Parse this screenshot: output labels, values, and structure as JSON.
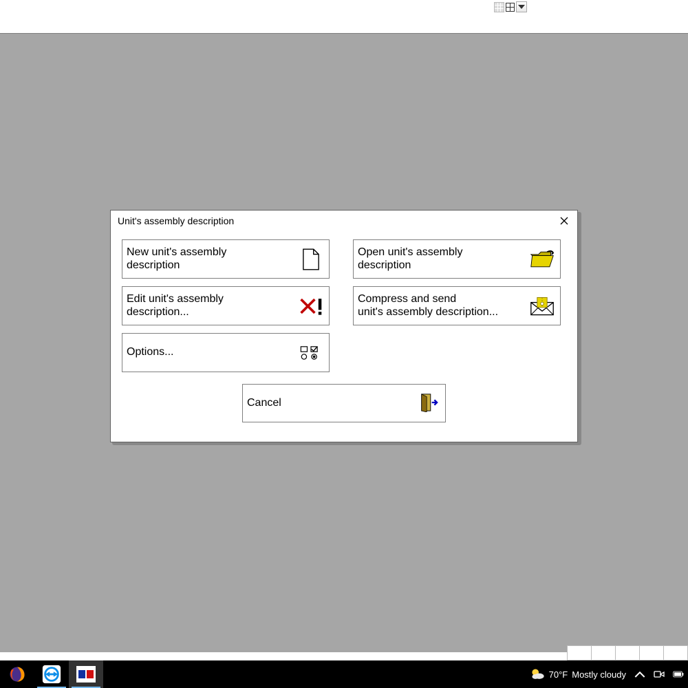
{
  "dialog": {
    "title": "Unit's assembly description",
    "buttons": {
      "new": "New unit's assembly\ndescription",
      "open": "Open unit's assembly\ndescription",
      "edit": "Edit unit's assembly\ndescription...",
      "send": "Compress and send\nunit's assembly description...",
      "options": "Options...",
      "cancel": "Cancel"
    }
  },
  "taskbar": {
    "weather_temp": "70°F",
    "weather_cond": "Mostly cloudy"
  }
}
